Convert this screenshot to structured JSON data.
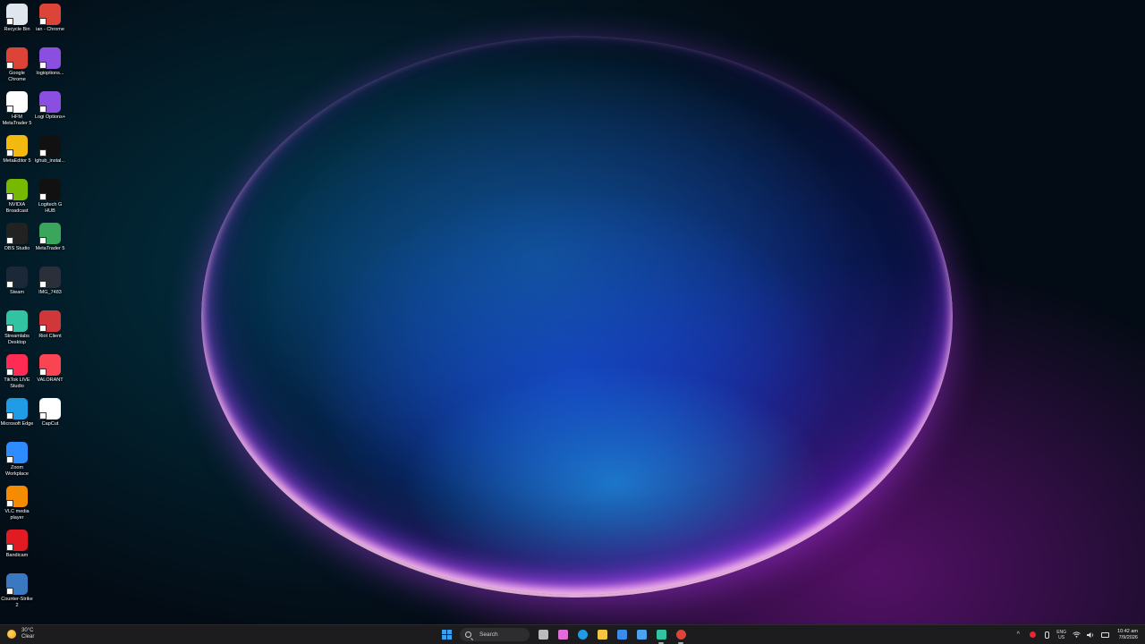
{
  "desktop": {
    "icons_left": [
      {
        "label": "Recycle Bin",
        "icon": "recycle-bin-icon",
        "color": "#dfe6ee"
      },
      {
        "label": "Google Chrome",
        "icon": "chrome-icon",
        "color": "#db4437"
      },
      {
        "label": "HFM MetaTrader 5",
        "icon": "hfm-metatrader-icon",
        "color": "#ffffff"
      },
      {
        "label": "MetaEditor 5",
        "icon": "metaeditor-icon",
        "color": "#f2b90f"
      },
      {
        "label": "NVIDIA Broadcast",
        "icon": "nvidia-broadcast-icon",
        "color": "#76b900"
      },
      {
        "label": "OBS Studio",
        "icon": "obs-icon",
        "color": "#222222"
      },
      {
        "label": "Steam",
        "icon": "steam-icon",
        "color": "#1b2838"
      },
      {
        "label": "Streamlabs Desktop",
        "icon": "streamlabs-icon",
        "color": "#31c3a2"
      },
      {
        "label": "TikTok LIVE Studio",
        "icon": "tiktok-live-icon",
        "color": "#fe2c55"
      },
      {
        "label": "Microsoft Edge",
        "icon": "edge-icon",
        "color": "#1f9ce5"
      },
      {
        "label": "Zoom Workplace",
        "icon": "zoom-icon",
        "color": "#2d8cff"
      },
      {
        "label": "VLC media player",
        "icon": "vlc-icon",
        "color": "#f48b00"
      },
      {
        "label": "Bandicam",
        "icon": "bandicam-icon",
        "color": "#e21a22"
      },
      {
        "label": "Counter-Strike 2",
        "icon": "counter-strike-icon",
        "color": "#3a78c2"
      }
    ],
    "icons_right": [
      {
        "label": "ian - Chrome",
        "icon": "chrome-profile-icon",
        "color": "#db4437"
      },
      {
        "label": "logioptions...",
        "icon": "logi-options-icon",
        "color": "#8b4fe0"
      },
      {
        "label": "Logi Options+",
        "icon": "logi-options-plus-icon",
        "color": "#8b4fe0"
      },
      {
        "label": "lghub_instal...",
        "icon": "lghub-installer-icon",
        "color": "#111111"
      },
      {
        "label": "Logitech G HUB",
        "icon": "logitech-ghub-icon",
        "color": "#111111"
      },
      {
        "label": "MetaTrader 5",
        "icon": "metatrader-icon",
        "color": "#3aa65b"
      },
      {
        "label": "IMG_7483",
        "icon": "image-file-icon",
        "color": "#2a2f3a"
      },
      {
        "label": "Riot Client",
        "icon": "riot-client-icon",
        "color": "#d13639"
      },
      {
        "label": "VALORANT",
        "icon": "valorant-icon",
        "color": "#fa4454"
      },
      {
        "label": "CapCut",
        "icon": "capcut-icon",
        "color": "#ffffff"
      }
    ]
  },
  "taskbar": {
    "weather": {
      "temp": "30°C",
      "condition": "Clear"
    },
    "search_placeholder": "Search",
    "apps": [
      {
        "name": "task-view",
        "color": "#bbbbbb"
      },
      {
        "name": "copilot",
        "color": "#e06cd8"
      },
      {
        "name": "edge",
        "color": "#1f9ce5"
      },
      {
        "name": "file-explorer",
        "color": "#f5c542"
      },
      {
        "name": "microsoft-store",
        "color": "#3b8beb"
      },
      {
        "name": "mail",
        "color": "#4aa3f0"
      },
      {
        "name": "streamlabs",
        "color": "#31c3a2"
      },
      {
        "name": "chrome",
        "color": "#db4437"
      }
    ],
    "tray": {
      "language_top": "ENG",
      "language_bottom": "US",
      "time": "10:42 am",
      "date": "7/9/2026"
    }
  }
}
